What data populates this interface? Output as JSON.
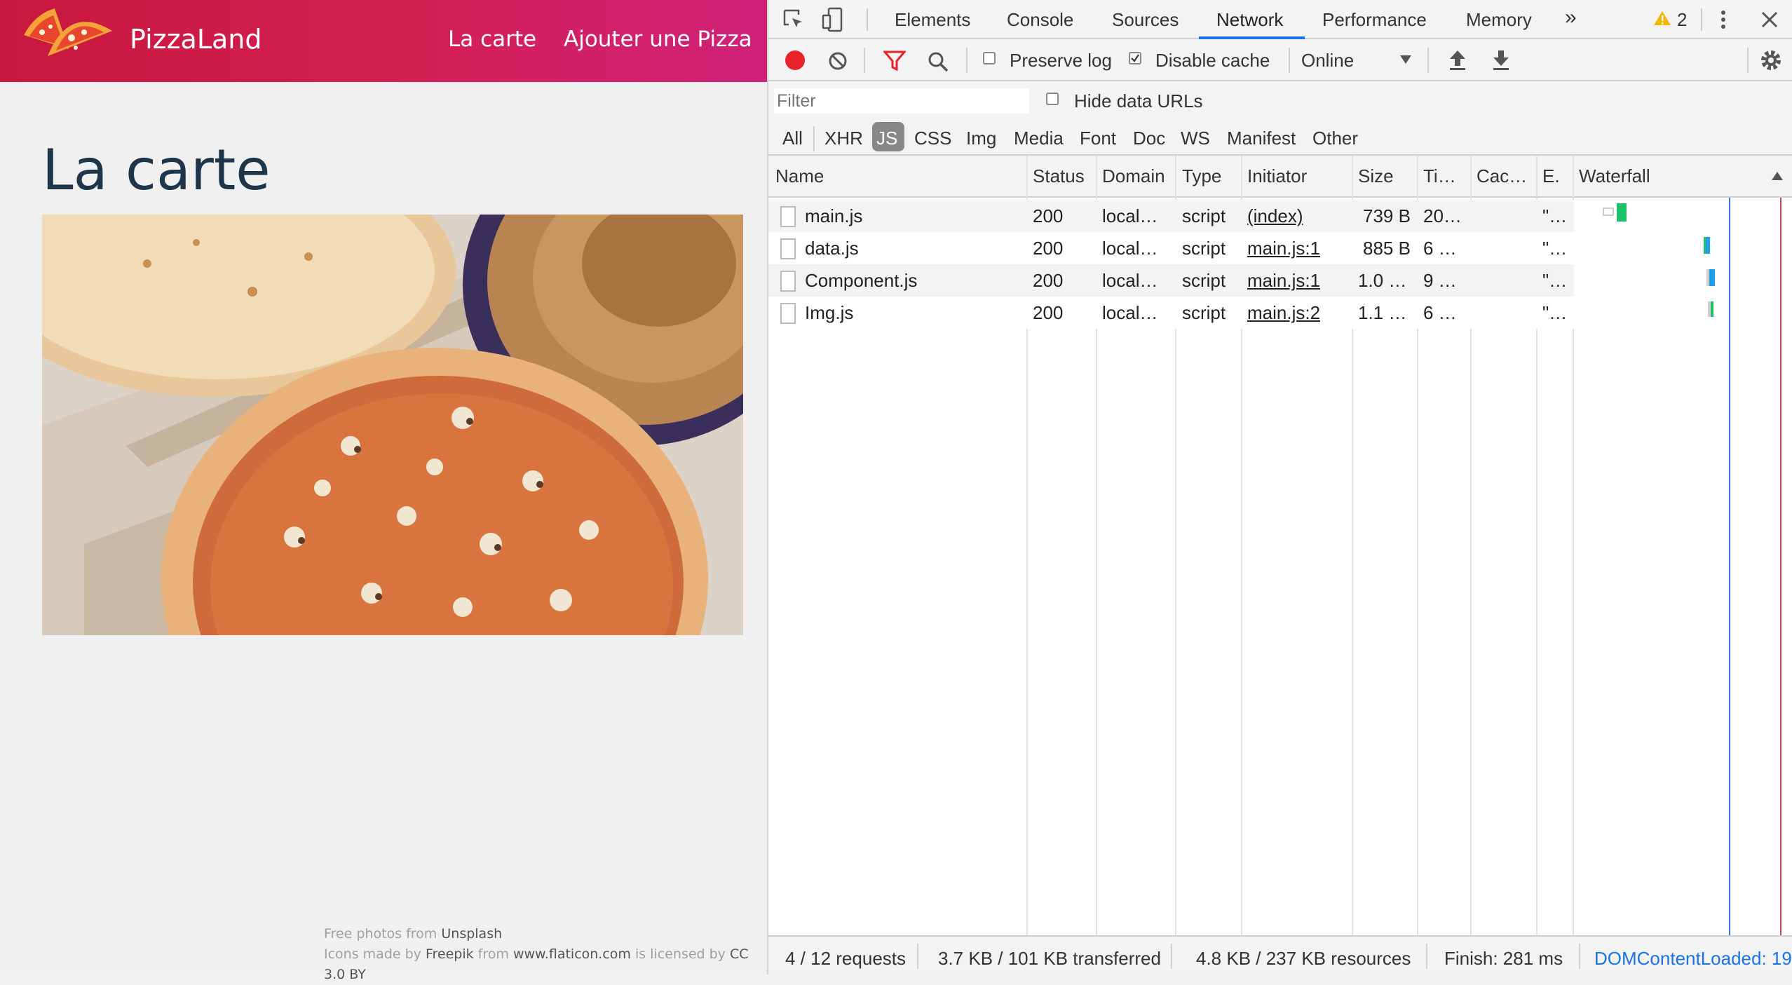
{
  "app": {
    "brand": "PizzaLand",
    "nav": [
      "La carte",
      "Ajouter une Pizza"
    ],
    "page_title": "La carte",
    "credits": {
      "line1_prefix": "Free photos from",
      "line1_link": "Unsplash",
      "line2_prefix": "Icons made by",
      "line2_author": "Freepik",
      "line2_from": "from",
      "line2_site": "www.flaticon.com",
      "line2_licensed": "is licensed by",
      "line2_license": "CC 3.0 BY"
    }
  },
  "devtools": {
    "tabs": [
      "Elements",
      "Console",
      "Sources",
      "Network",
      "Performance",
      "Memory"
    ],
    "active_tab": "Network",
    "more_tabs": "»",
    "warning_count": "2",
    "toolbar": {
      "preserve_log": "Preserve log",
      "preserve_log_checked": false,
      "disable_cache": "Disable cache",
      "disable_cache_checked": true,
      "throttling": "Online"
    },
    "filter_placeholder": "Filter",
    "hide_data_urls": "Hide data URLs",
    "types": [
      "All",
      "XHR",
      "JS",
      "CSS",
      "Img",
      "Media",
      "Font",
      "Doc",
      "WS",
      "Manifest",
      "Other"
    ],
    "active_type": "JS",
    "columns": [
      "Name",
      "Status",
      "Domain",
      "Type",
      "Initiator",
      "Size",
      "Ti…",
      "Cac…",
      "E.",
      "Waterfall"
    ],
    "rows": [
      {
        "name": "main.js",
        "status": "200",
        "domain": "local…",
        "type": "script",
        "initiator": "(index)",
        "size": "739 B",
        "time": "20…",
        "cache": "",
        "e": "\"…"
      },
      {
        "name": "data.js",
        "status": "200",
        "domain": "local…",
        "type": "script",
        "initiator": "main.js:1",
        "size": "885 B",
        "time": "6 …",
        "cache": "",
        "e": "\"…"
      },
      {
        "name": "Component.js",
        "status": "200",
        "domain": "local…",
        "type": "script",
        "initiator": "main.js:1",
        "size": "1.0 …",
        "time": "9 …",
        "cache": "",
        "e": "\"…"
      },
      {
        "name": "Img.js",
        "status": "200",
        "domain": "local…",
        "type": "script",
        "initiator": "main.js:2",
        "size": "1.1 …",
        "time": "6 …",
        "cache": "",
        "e": "\"…"
      }
    ],
    "status_bar": {
      "requests": "4 / 12 requests",
      "transferred": "3.7 KB / 101 KB transferred",
      "resources": "4.8 KB / 237 KB resources",
      "finish": "Finish: 281 ms",
      "dom_content_loaded": "DOMContentLoaded: 19"
    }
  }
}
